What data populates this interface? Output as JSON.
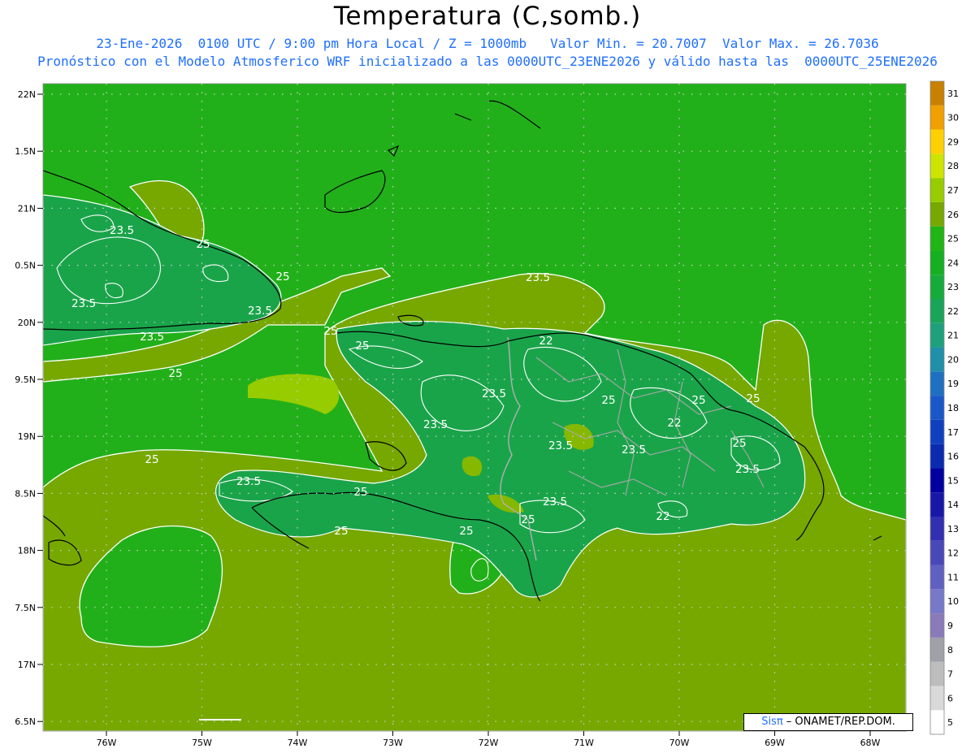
{
  "header": {
    "title": "Temperatura (C,somb.)",
    "line1": "23-Ene-2026  0100 UTC / 9:00 pm Hora Local / Z = 1000mb   Valor Min. = 20.7007  Valor Max. = 26.7036",
    "line2": "Pronóstico con el Modelo Atmosferico WRF inicializado a las 0000UTC_23ENE2026 y válido hasta las  0000UTC_25ENE2026"
  },
  "axes": {
    "lat_labels": [
      "22N",
      "1.5N",
      "21N",
      "0.5N",
      "20N",
      "9.5N",
      "19N",
      "8.5N",
      "18N",
      "7.5N",
      "17N",
      "6.5N"
    ],
    "lon_labels": [
      "76W",
      "75W",
      "74W",
      "73W",
      "72W",
      "71W",
      "70W",
      "69W",
      "68W"
    ]
  },
  "colorbar": {
    "labels": [
      "5",
      "6",
      "7",
      "8",
      "9",
      "10",
      "11",
      "12",
      "13",
      "14",
      "15",
      "16",
      "17",
      "18",
      "19",
      "20",
      "21",
      "22",
      "23",
      "24",
      "25",
      "26",
      "27",
      "28",
      "29",
      "30",
      "31"
    ],
    "colors": [
      "#ffffff",
      "#d9d9d9",
      "#bdbdbd",
      "#a0a0a8",
      "#8a7ab8",
      "#7878c8",
      "#6060c0",
      "#4848b8",
      "#3030b0",
      "#1818a8",
      "#0000a0",
      "#0a2ab0",
      "#1040c0",
      "#1a58c8",
      "#1f70c0",
      "#2090a8",
      "#1fa07c",
      "#1aa45a",
      "#16ac3c",
      "#14b020",
      "#20b414",
      "#76a800",
      "#96cc00",
      "#cce400",
      "#ffd000",
      "#f0a000",
      "#c88000"
    ]
  },
  "contours": {
    "labels": [
      "23.5",
      "25",
      "25",
      "23.5",
      "23.5",
      "23.5",
      "25",
      "25",
      "25",
      "23.5",
      "23.5",
      "23.5",
      "22",
      "25",
      "25",
      "23.5",
      "25",
      "23.5",
      "25",
      "22",
      "23.5",
      "23.5",
      "22",
      "23.5",
      "25",
      "25",
      "25",
      "25",
      "25"
    ]
  },
  "credit": {
    "sis": "Sisπ",
    "rest": " – ONAMET/REP.DOM."
  }
}
